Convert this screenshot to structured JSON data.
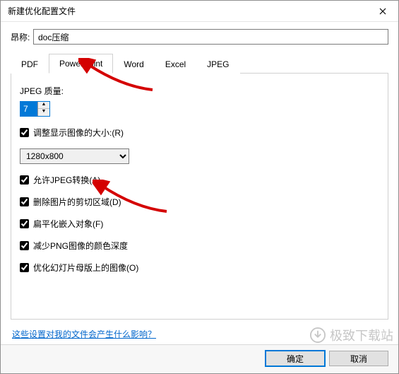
{
  "window": {
    "title": "新建优化配置文件"
  },
  "nickname": {
    "label": "昂称:",
    "value": "doc压缩"
  },
  "tabs": {
    "pdf": "PDF",
    "powerpoint": "PowerPoint",
    "word": "Word",
    "excel": "Excel",
    "jpeg": "JPEG"
  },
  "ppt": {
    "jpeg_quality_label": "JPEG 质量:",
    "jpeg_quality_value": "7",
    "resize_label": "调整显示图像的大小:(R)",
    "resize_checked": true,
    "resize_value": "1280x800",
    "resize_options": [
      "1280x800"
    ],
    "allow_jpeg_label": "允许JPEG转换(A)",
    "allow_jpeg_checked": true,
    "delete_crop_label": "删除图片的剪切区域(D)",
    "delete_crop_checked": true,
    "flatten_label": "扁平化嵌入对象(F)",
    "flatten_checked": true,
    "reduce_png_label": "减少PNG图像的颜色深度",
    "reduce_png_checked": true,
    "optimize_master_label": "优化幻灯片母版上的图像(O)",
    "optimize_master_checked": true
  },
  "help": {
    "link": "这些设置对我的文件会产生什么影响？"
  },
  "footer": {
    "ok": "确定",
    "cancel": "取消"
  },
  "watermark": {
    "text": "极致下载站"
  }
}
